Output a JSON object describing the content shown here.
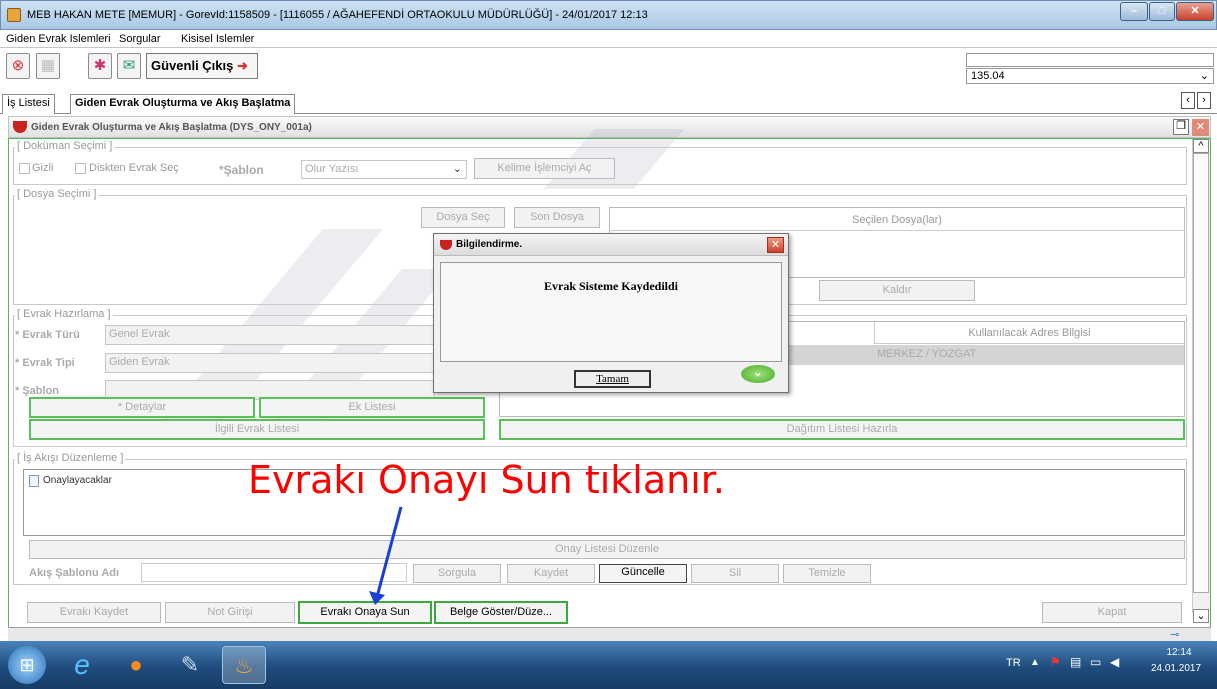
{
  "window": {
    "title": "MEB  HAKAN METE  [MEMUR] - GorevId:1158509 - [1116055 / AĞAHEFENDİ ORTAOKULU MÜDÜRLÜĞÜ] - 24/01/2017 12:13"
  },
  "menu": [
    "Giden Evrak Islemleri",
    "Sorgular",
    "Kisisel Islemler"
  ],
  "toolbar": {
    "exit_label": "Güvenli Çıkış",
    "combo_value": "135.04"
  },
  "tabs": [
    "İş Listesi",
    "Giden Evrak Oluşturma ve Akış Başlatma"
  ],
  "form": {
    "title": "Giden Evrak Oluşturma ve Akış Başlatma (DYS_ONY_001a)",
    "dokuman": {
      "legend": "[ Doküman Seçimi ]",
      "gizli": "Gizli",
      "disk": "Diskten Evrak Seç",
      "sablon_label": "*Şablon",
      "sablon_value": "Olur Yazısı",
      "kelime_button": "Kelime İşlemciyi Aç"
    },
    "dosya": {
      "legend": "[ Dosya Seçimi ]",
      "dosya_sec": "Dosya Seç",
      "son_dosya": "Son Dosya",
      "secilen_header": "Seçilen Dosya(lar)",
      "kaldir": "Kaldır"
    },
    "hazirlama": {
      "legend": "[ Evrak Hazırlama ]",
      "evrak_turu_label": "* Evrak Türü",
      "evrak_turu_value": "Genel Evrak",
      "evrak_tipi_label": "* Evrak Tipi",
      "evrak_tipi_value": "Giden Evrak",
      "sablon_label": "* Şablon",
      "detaylar": "* Detaylar",
      "ek_listesi": "Ek Listesi",
      "ilgili": "İlgili Evrak Listesi",
      "adres_header": "Kullanılacak Adres Bilgisi",
      "adres_row": "MERKEZ / YOZGAT",
      "dagitim": "Dağıtım Listesi Hazırla"
    },
    "akis": {
      "legend": "[ İş Akışı Düzenleme ]",
      "onaylayacaklar": "Onaylayacaklar",
      "onay_listesi": "Onay Listesi Düzenle",
      "sablon_adi_label": "Akış Şablonu Adı",
      "sorgula": "Sorgula",
      "kaydet": "Kaydet",
      "guncelle": "Güncelle",
      "sil": "Sil",
      "temizle": "Temizle"
    },
    "bottom": {
      "evraki_kaydet": "Evrakı Kaydet",
      "not_girisi": "Not Girişi",
      "onaya_sun": "Evrakı Onaya Sun",
      "belge_goster": "Belge Göster/Düze...",
      "kapat": "Kapat"
    }
  },
  "dialog": {
    "title": "Bilgilendirme.",
    "message": "Evrak Sisteme Kaydedildi",
    "ok": "Tamam"
  },
  "annotation": "Evrakı Onayı Sun tıklanır.",
  "taskbar": {
    "lang": "TR",
    "time": "12:14",
    "date": "24.01.2017"
  },
  "colors": {
    "accent_green": "#58c058",
    "annotation_red": "#ff0000",
    "arrow_blue": "#1a3fd6"
  }
}
